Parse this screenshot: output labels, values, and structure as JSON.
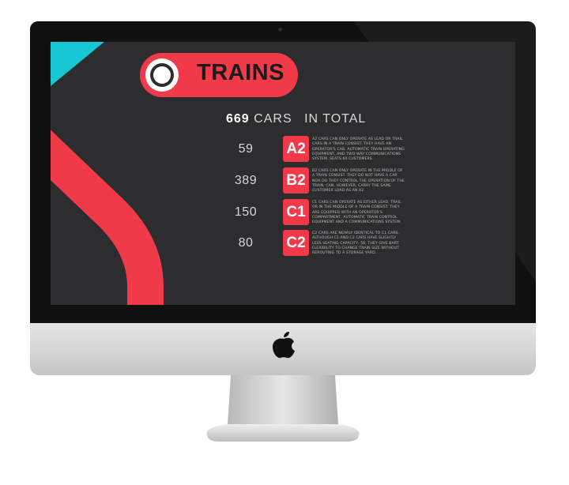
{
  "header": {
    "title": "TRAINS"
  },
  "total": {
    "count": "669",
    "unit": "CARS",
    "suffix": "IN TOTAL"
  },
  "rows": [
    {
      "count": "59",
      "code": "A2",
      "description": "A2 cars can only operate as lead or trail cars in a train consist. They have an operator's cab, automatic train operating equipment, and two-way communications system. Seats 60 customers."
    },
    {
      "count": "389",
      "code": "B2",
      "description": "B2 cars can only operate in the middle of a train consist. They do not have a car nor do they control the operation of the train. Can, however, carry the same customer load as an A2."
    },
    {
      "count": "150",
      "code": "C1",
      "description": "C1 cars can operate as either lead, trail or in the middle of a train consist. They are equipped with an operator's compartment, automatic train control equipment and a communications system."
    },
    {
      "count": "80",
      "code": "C2",
      "description": "C2 cars are nearly identical to C1 cars. Although C1 and C2 cars have slightly less seating capacity, 56, they give BART flexibility to change train size without rerouting to a storage yard."
    }
  ],
  "colors": {
    "accent": "#f03a4a",
    "cyan": "#17c8d4",
    "screen": "#2d2c2e"
  },
  "icons": {
    "brand": "apple-logo-icon",
    "header": "ring-icon"
  }
}
